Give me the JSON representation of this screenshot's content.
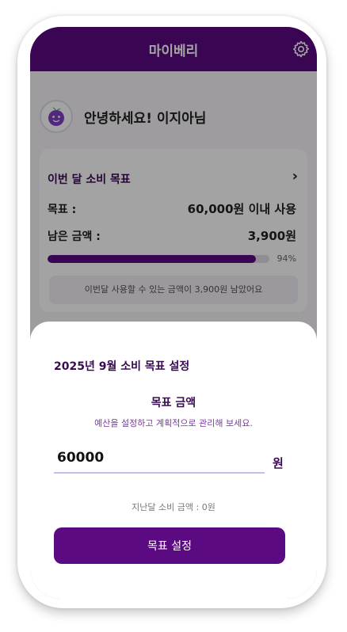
{
  "header": {
    "title": "마이베리"
  },
  "greeting": {
    "avatar_icon": "berry-icon",
    "text": "안녕하세요!  이지아님"
  },
  "goal_card": {
    "title": "이번 달 소비 목표",
    "goal_label": "목표 :",
    "goal_value": "60,000원 이내 사용",
    "remaining_label": "남은 금액 :",
    "remaining_value": "3,900원",
    "progress_percent": 94,
    "progress_text": "94%",
    "notice": "이번달 사용할 수 있는 금액이 3,900원 남았어요"
  },
  "sheet": {
    "title": "2025년 9월 소비 목표 설정",
    "amount_label": "목표 금액",
    "amount_description": "예산을 설정하고 계획적으로 관리해 보세요.",
    "amount_value": "60000",
    "currency_unit": "원",
    "last_month_text": "지난달 소비 금액 : 0원",
    "submit_label": "목표 설정"
  },
  "colors": {
    "primary": "#5c0a82",
    "accent_text": "#3a0a55",
    "input_underline": "#c7bcf0"
  }
}
